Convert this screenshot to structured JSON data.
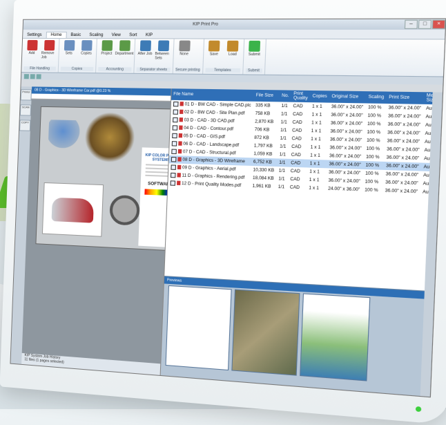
{
  "app": {
    "title": "KIP Print Pro"
  },
  "menu": [
    "Settings",
    "Home",
    "Basic",
    "Scaling",
    "View",
    "Sort",
    "KIP"
  ],
  "menu_active": "Home",
  "ribbon": [
    {
      "label": "File Handling",
      "buttons": [
        "Add",
        "Remove Job"
      ]
    },
    {
      "label": "Copies",
      "buttons": [
        "Sets",
        "Copies"
      ]
    },
    {
      "label": "Accounting",
      "buttons": [
        "Project",
        "Department"
      ]
    },
    {
      "label": "Separator sheets",
      "buttons": [
        "After Job",
        "Between Sets"
      ]
    },
    {
      "label": "Secure printing",
      "buttons": [
        "None"
      ]
    },
    {
      "label": "Templates",
      "buttons": [
        "Save",
        "Load"
      ]
    },
    {
      "label": "Submit",
      "buttons": [
        "Submit"
      ]
    }
  ],
  "preview_tab": "08 D - Graphics - 3D Wireframe Car.pdf @0.23 %",
  "left_tabs": [
    "Printer",
    "SCAN",
    "COPY"
  ],
  "brand": {
    "title": "KIP COLOR PRINT SYSTEMS",
    "logo": "SOFTWARE"
  },
  "columns": [
    "File Name",
    "File Size",
    "No.",
    "Print Quality",
    "Copies",
    "Original Size",
    "Scaling",
    "Print Size",
    "Media Size"
  ],
  "files": [
    {
      "name": "01 D - BW CAD - Simple CAD.plc",
      "size": "335 KB",
      "no": "1/1",
      "quality": "CAD",
      "copies": "1 x 1",
      "orig": "36.00\" x 24.00\"",
      "scaling": "100 %",
      "print": "36.00\" x 24.00\"",
      "media": "Auto"
    },
    {
      "name": "02 D - BW CAD - Site Plan.pdf",
      "size": "758 KB",
      "no": "1/1",
      "quality": "CAD",
      "copies": "1 x 1",
      "orig": "36.00\" x 24.00\"",
      "scaling": "100 %",
      "print": "36.00\" x 24.00\"",
      "media": "Auto"
    },
    {
      "name": "03 D - CAD - 3D CAD.pdf",
      "size": "2,870 KB",
      "no": "1/1",
      "quality": "CAD",
      "copies": "1 x 1",
      "orig": "36.00\" x 24.00\"",
      "scaling": "100 %",
      "print": "36.00\" x 24.00\"",
      "media": "Auto"
    },
    {
      "name": "04 D - CAD - Contour.pdf",
      "size": "706 KB",
      "no": "1/1",
      "quality": "CAD",
      "copies": "1 x 1",
      "orig": "36.00\" x 24.00\"",
      "scaling": "100 %",
      "print": "36.00\" x 24.00\"",
      "media": "Auto"
    },
    {
      "name": "05 D - CAD - GIS.pdf",
      "size": "872 KB",
      "no": "1/1",
      "quality": "CAD",
      "copies": "1 x 1",
      "orig": "36.00\" x 24.00\"",
      "scaling": "100 %",
      "print": "36.00\" x 24.00\"",
      "media": "Auto"
    },
    {
      "name": "06 D - CAD - Landscape.pdf",
      "size": "1,797 KB",
      "no": "1/1",
      "quality": "CAD",
      "copies": "1 x 1",
      "orig": "36.00\" x 24.00\"",
      "scaling": "100 %",
      "print": "36.00\" x 24.00\"",
      "media": "Auto"
    },
    {
      "name": "07 D - CAD - Structural.pdf",
      "size": "1,059 KB",
      "no": "1/1",
      "quality": "CAD",
      "copies": "1 x 1",
      "orig": "36.00\" x 24.00\"",
      "scaling": "100 %",
      "print": "36.00\" x 24.00\"",
      "media": "Auto"
    },
    {
      "name": "08 D - Graphics - 3D Wireframe",
      "size": "6,752 KB",
      "no": "1/1",
      "quality": "CAD",
      "copies": "1 x 1",
      "orig": "36.00\" x 24.00\"",
      "scaling": "100 %",
      "print": "36.00\" x 24.00\"",
      "media": "Auto"
    },
    {
      "name": "09 D - Graphics - Aerial.pdf",
      "size": "10,330 KB",
      "no": "1/1",
      "quality": "CAD",
      "copies": "1 x 1",
      "orig": "36.00\" x 24.00\"",
      "scaling": "100 %",
      "print": "36.00\" x 24.00\"",
      "media": "Auto"
    },
    {
      "name": "11 D - Graphics - Rendering.pdf",
      "size": "18,084 KB",
      "no": "1/1",
      "quality": "CAD",
      "copies": "1 x 1",
      "orig": "36.00\" x 24.00\"",
      "scaling": "100 %",
      "print": "36.00\" x 24.00\"",
      "media": "Auto"
    },
    {
      "name": "12 D - Print Quality Modes.pdf",
      "size": "1,961 KB",
      "no": "1/1",
      "quality": "CAD",
      "copies": "1 x 1",
      "orig": "24.00\" x 36.00\"",
      "scaling": "100 %",
      "print": "36.00\" x 24.00\"",
      "media": "Auto"
    }
  ],
  "selected_index": 7,
  "previews_label": "Previews",
  "status": {
    "line1": "KIP System Job History",
    "line2": "11 files (1 pages selected)"
  },
  "colors": {
    "accent": "#2d6fb6",
    "selection": "#bcd6f3",
    "ribbon_bg": "#e8eef4"
  }
}
